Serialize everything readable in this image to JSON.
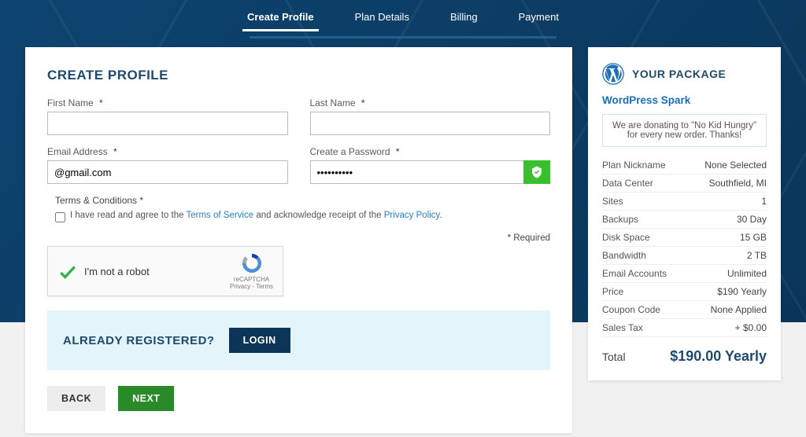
{
  "steps": {
    "s1": "Create Profile",
    "s2": "Plan Details",
    "s3": "Billing",
    "s4": "Payment"
  },
  "form": {
    "title": "CREATE PROFILE",
    "first_name_label": "First Name",
    "last_name_label": "Last Name",
    "email_label": "Email Address",
    "email_value": "@gmail.com",
    "password_label": "Create a Password",
    "password_value": "••••••••••",
    "asterisk": "*",
    "terms_title": "Terms & Conditions *",
    "terms_pre": "I have read and agree to the ",
    "tos_link": "Terms of Service",
    "terms_mid": " and acknowledge receipt of the ",
    "privacy_link": "Privacy Policy",
    "terms_post": ".",
    "required_note": "* Required",
    "captcha_label": "I'm not a robot",
    "captcha_brand": "reCAPTCHA",
    "captcha_legal": "Privacy - Terms",
    "already_text": "ALREADY REGISTERED?",
    "login_btn": "LOGIN",
    "back_btn": "BACK",
    "next_btn": "NEXT"
  },
  "package": {
    "heading": "YOUR PACKAGE",
    "name": "WordPress Spark",
    "donate_l1": "We are donating to \"No Kid Hungry\"",
    "donate_l2": "for every new order. Thanks!",
    "rows": {
      "nickname_l": "Plan Nickname",
      "nickname_v": "None Selected",
      "dc_l": "Data Center",
      "dc_v": "Southfield, MI",
      "sites_l": "Sites",
      "sites_v": "1",
      "backups_l": "Backups",
      "backups_v": "30 Day",
      "disk_l": "Disk Space",
      "disk_v": "15 GB",
      "bw_l": "Bandwidth",
      "bw_v": "2 TB",
      "email_l": "Email Accounts",
      "email_v": "Unlimited",
      "price_l": "Price",
      "price_v": "$190 Yearly",
      "coupon_l": "Coupon Code",
      "coupon_v": "None Applied",
      "tax_l": "Sales Tax",
      "tax_v": "+ $0.00"
    },
    "total_l": "Total",
    "total_v": "$190.00 Yearly"
  }
}
